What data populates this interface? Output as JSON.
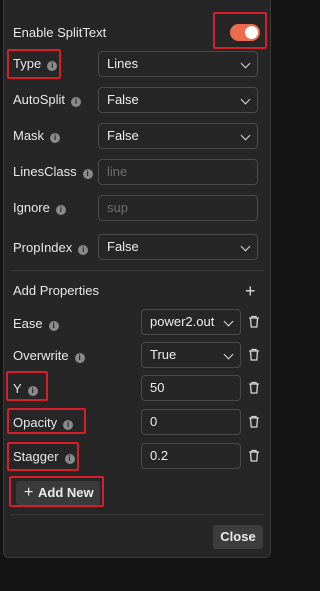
{
  "enable": {
    "label": "Enable SplitText",
    "on": true,
    "accent": "#ef6a4c"
  },
  "settings": {
    "type": {
      "label": "Type",
      "value": "Lines"
    },
    "autosplit": {
      "label": "AutoSplit",
      "value": "False"
    },
    "mask": {
      "label": "Mask",
      "value": "False"
    },
    "linesclass": {
      "label": "LinesClass",
      "placeholder": "line"
    },
    "ignore": {
      "label": "Ignore",
      "placeholder": "sup"
    },
    "propindex": {
      "label": "PropIndex",
      "value": "False"
    }
  },
  "properties": {
    "heading": "Add Properties",
    "ease": {
      "label": "Ease",
      "value": "power2.out"
    },
    "overwrite": {
      "label": "Overwrite",
      "value": "True"
    },
    "y": {
      "label": "Y",
      "value": "50"
    },
    "opacity": {
      "label": "Opacity",
      "value": "0"
    },
    "stagger": {
      "label": "Stagger",
      "value": "0.2"
    },
    "add_new": "Add New"
  },
  "footer": {
    "close": "Close"
  },
  "icons": {
    "info": "info-icon",
    "chevron": "chevron-down-icon",
    "trash": "trash-icon",
    "plus": "plus-icon"
  },
  "highlight_color": "#d81e2a"
}
